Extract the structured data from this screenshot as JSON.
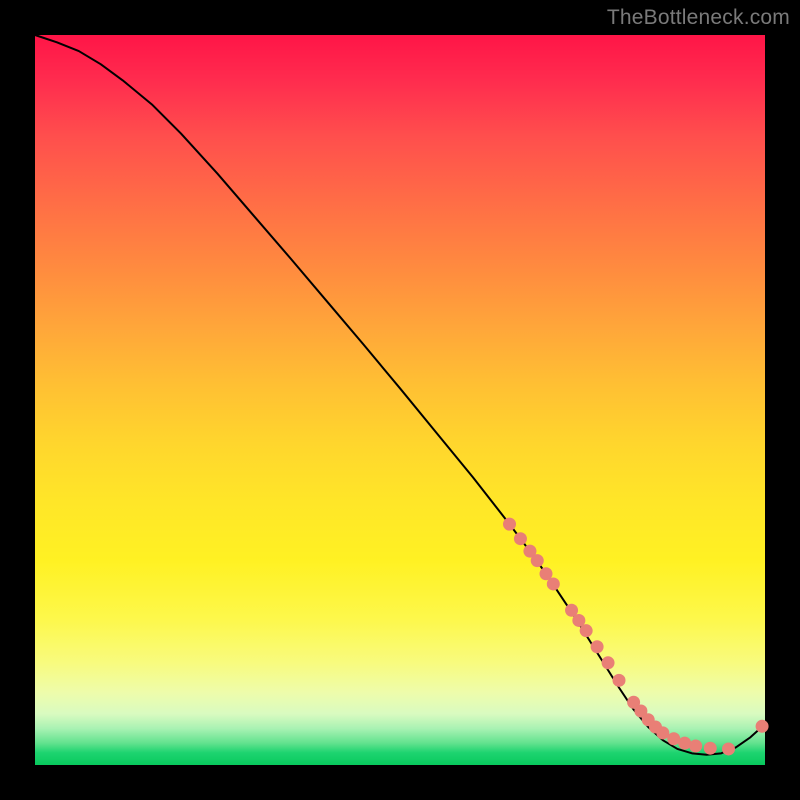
{
  "watermark": "TheBottleneck.com",
  "chart_data": {
    "type": "line",
    "title": "",
    "xlabel": "",
    "ylabel": "",
    "xlim": [
      0,
      100
    ],
    "ylim": [
      0,
      100
    ],
    "grid": false,
    "legend": false,
    "series": [
      {
        "name": "bottleneck-curve",
        "x": [
          0,
          3,
          6,
          9,
          12,
          16,
          20,
          25,
          30,
          35,
          40,
          45,
          50,
          55,
          60,
          65,
          68,
          70,
          72,
          74,
          76,
          78,
          80,
          82,
          84,
          86,
          88,
          90,
          92,
          94,
          96,
          98,
          100
        ],
        "y": [
          100,
          99,
          97.8,
          96,
          93.8,
          90.5,
          86.5,
          81,
          75.2,
          69.4,
          63.5,
          57.6,
          51.6,
          45.5,
          39.4,
          33,
          29,
          26.2,
          23.2,
          20.2,
          17,
          13.8,
          10.6,
          7.6,
          5.2,
          3.4,
          2.2,
          1.6,
          1.4,
          1.6,
          2.4,
          3.8,
          5.6
        ]
      }
    ],
    "markers": {
      "name": "highlighted-points",
      "x": [
        65,
        66.5,
        67.8,
        68.8,
        70,
        71,
        73.5,
        74.5,
        75.5,
        77,
        78.5,
        80,
        82,
        83,
        84,
        85,
        86,
        87.5,
        89,
        90.5,
        92.5,
        95,
        99.6
      ],
      "y": [
        33,
        31,
        29.3,
        28,
        26.2,
        24.8,
        21.2,
        19.8,
        18.4,
        16.2,
        14,
        11.6,
        8.6,
        7.4,
        6.2,
        5.2,
        4.4,
        3.6,
        3.0,
        2.6,
        2.3,
        2.2,
        5.3
      ]
    }
  },
  "gradient_stops": [
    {
      "pos": 0,
      "color": "#ff1547"
    },
    {
      "pos": 50,
      "color": "#ffd62d"
    },
    {
      "pos": 90,
      "color": "#eefcaa"
    },
    {
      "pos": 100,
      "color": "#08c95d"
    }
  ]
}
